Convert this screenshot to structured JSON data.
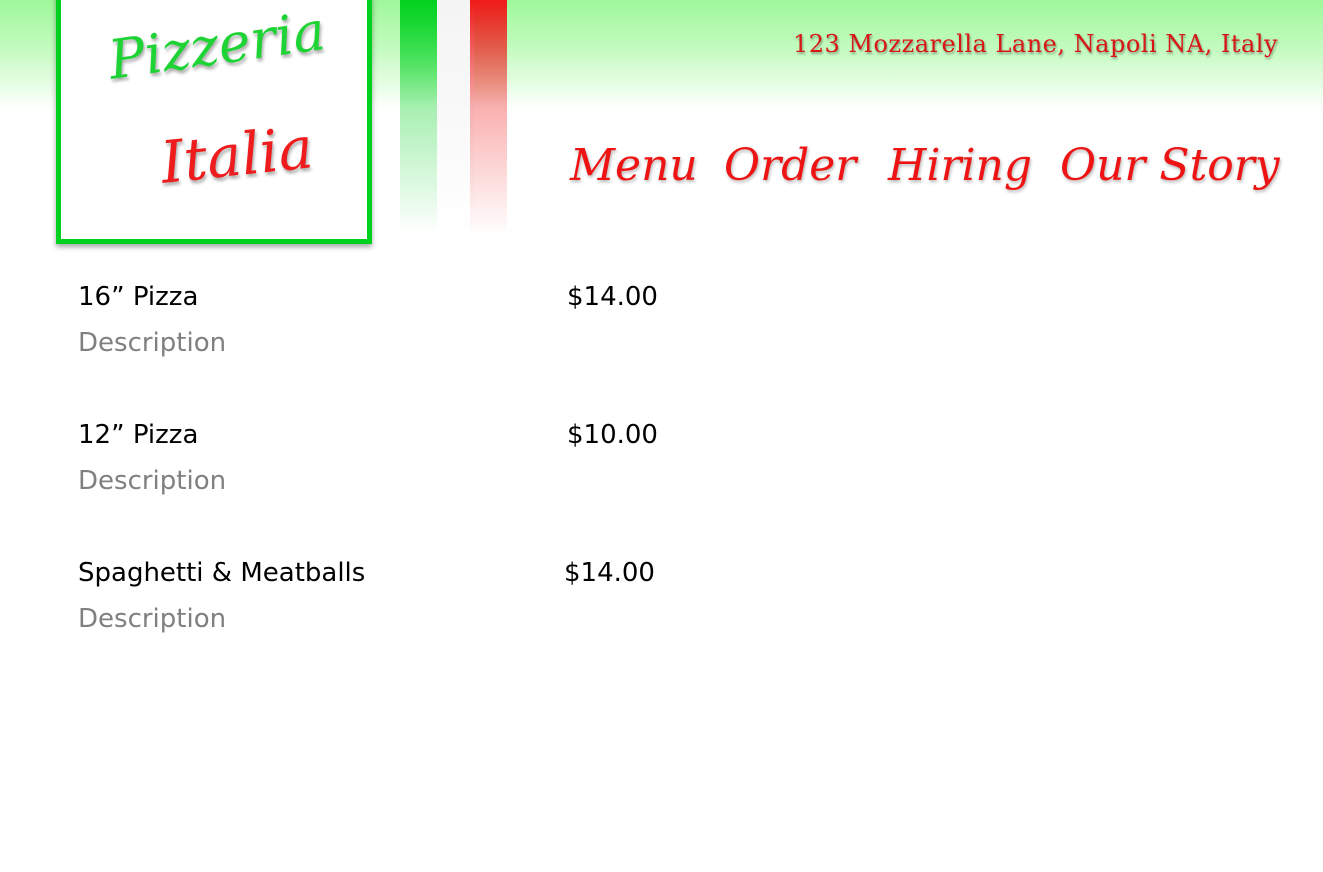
{
  "brand": {
    "line1": "Pizzeria",
    "line2": "Italia"
  },
  "header": {
    "address": "123 Mozzarella Lane, Napoli NA, Italy"
  },
  "nav": {
    "items": [
      {
        "label": "Menu"
      },
      {
        "label": "Order"
      },
      {
        "label": "Hiring"
      },
      {
        "label": "Our Story"
      }
    ]
  },
  "menu": {
    "items": [
      {
        "name": "16” Pizza",
        "price": "$14.00",
        "description": "Description"
      },
      {
        "name": "12” Pizza",
        "price": "$10.00",
        "description": "Description"
      },
      {
        "name": "Spaghetti & Meatballs",
        "price": "$14.00",
        "description": "Description"
      }
    ]
  },
  "colors": {
    "green": "#00d21f",
    "red": "#ee1414",
    "header_gradient": "#9ef89a"
  }
}
